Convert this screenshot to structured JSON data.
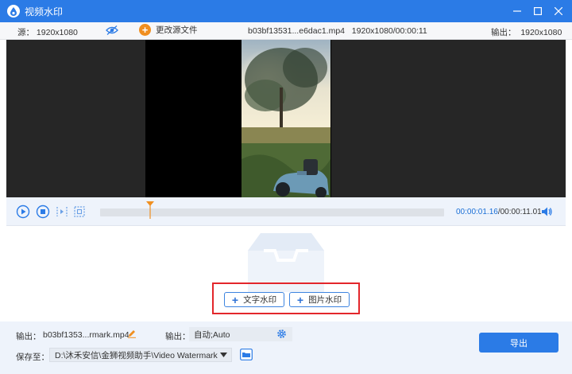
{
  "window": {
    "title": "视频水印"
  },
  "infobar": {
    "source_label": "源：",
    "source_res": "1920x1080",
    "change_source": "更改源文件",
    "filename": "b03bf13531...e6dac1.mp4",
    "file_info": "1920x1080/00:00:11",
    "output_label": "输出：",
    "output_res": "1920x1080"
  },
  "player": {
    "current_time": "00:00:01.16",
    "total_time": "/00:00:11.01",
    "progress": 0.145
  },
  "watermark": {
    "text_button": "文字水印",
    "image_button": "图片水印"
  },
  "output": {
    "file_label": "输出：",
    "file_name": "b03bf1353...rmark.mp4",
    "format_label": "输出：",
    "format_value": "自动;Auto",
    "save_label": "保存至：",
    "save_path": "D:\\沐禾安信\\金狮视频助手\\Video Watermark",
    "export_button": "导出"
  },
  "colors": {
    "accent": "#2b7be6",
    "highlight": "#e3262b",
    "orange": "#f08f20"
  }
}
